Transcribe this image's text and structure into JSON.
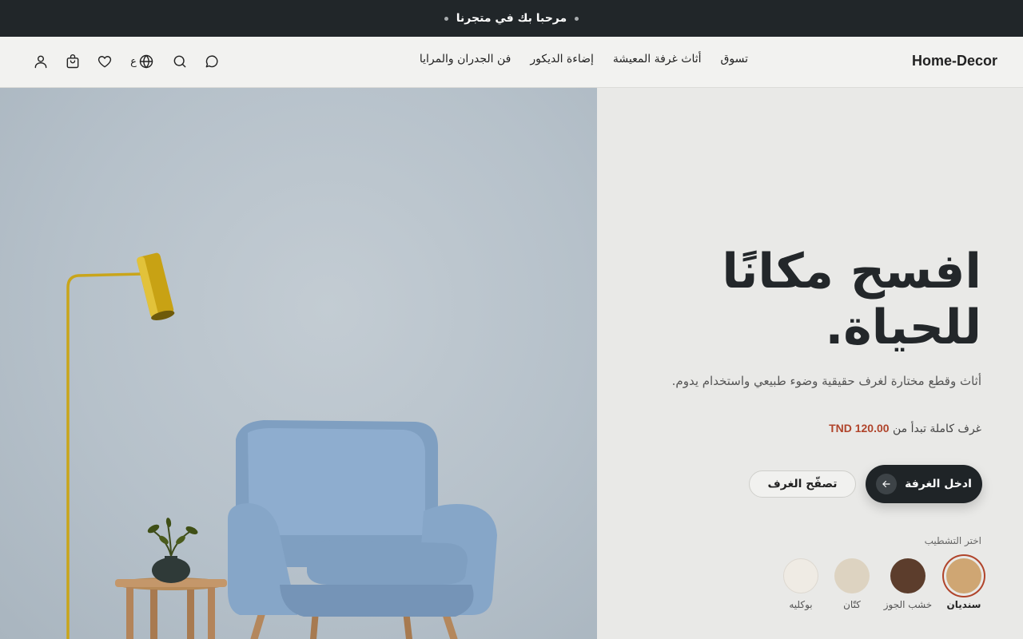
{
  "topbar": {
    "message": "مرحبا بك في متجرنا"
  },
  "header": {
    "logo": "Home-Decor",
    "nav": [
      "تسوق",
      "أثاث غرفة المعيشة",
      "إضاءة الديكور",
      "فن الجدران والمرايا"
    ],
    "language_label": "ع",
    "icons": [
      "chat-icon",
      "search-icon",
      "globe-icon",
      "heart-icon",
      "cart-icon",
      "user-icon"
    ]
  },
  "hero": {
    "title_line1": "افسح مكانًا",
    "title_line2": "للحياة.",
    "subtitle": "أثاث وقطع مختارة لغرف حقيقية وضوء طبيعي واستخدام يدوم.",
    "price_prefix": "غرف كاملة تبدأ من",
    "price": "TND 120.00",
    "primary_button": "ادخل الغرفة",
    "secondary_button": "تصفّح الغرف",
    "finish_label": "اختر التشطيب",
    "finishes": [
      {
        "name": "سنديان",
        "color": "#cfa673",
        "selected": true
      },
      {
        "name": "خشب الجوز",
        "color": "#5c3d2c",
        "selected": false
      },
      {
        "name": "كتّان",
        "color": "#ddd3c1",
        "selected": false
      },
      {
        "name": "بوكليه",
        "color": "#efebe4",
        "selected": false
      }
    ]
  },
  "colors": {
    "dark": "#212629",
    "accent": "#b0442b",
    "background": "#e9e9e7"
  }
}
